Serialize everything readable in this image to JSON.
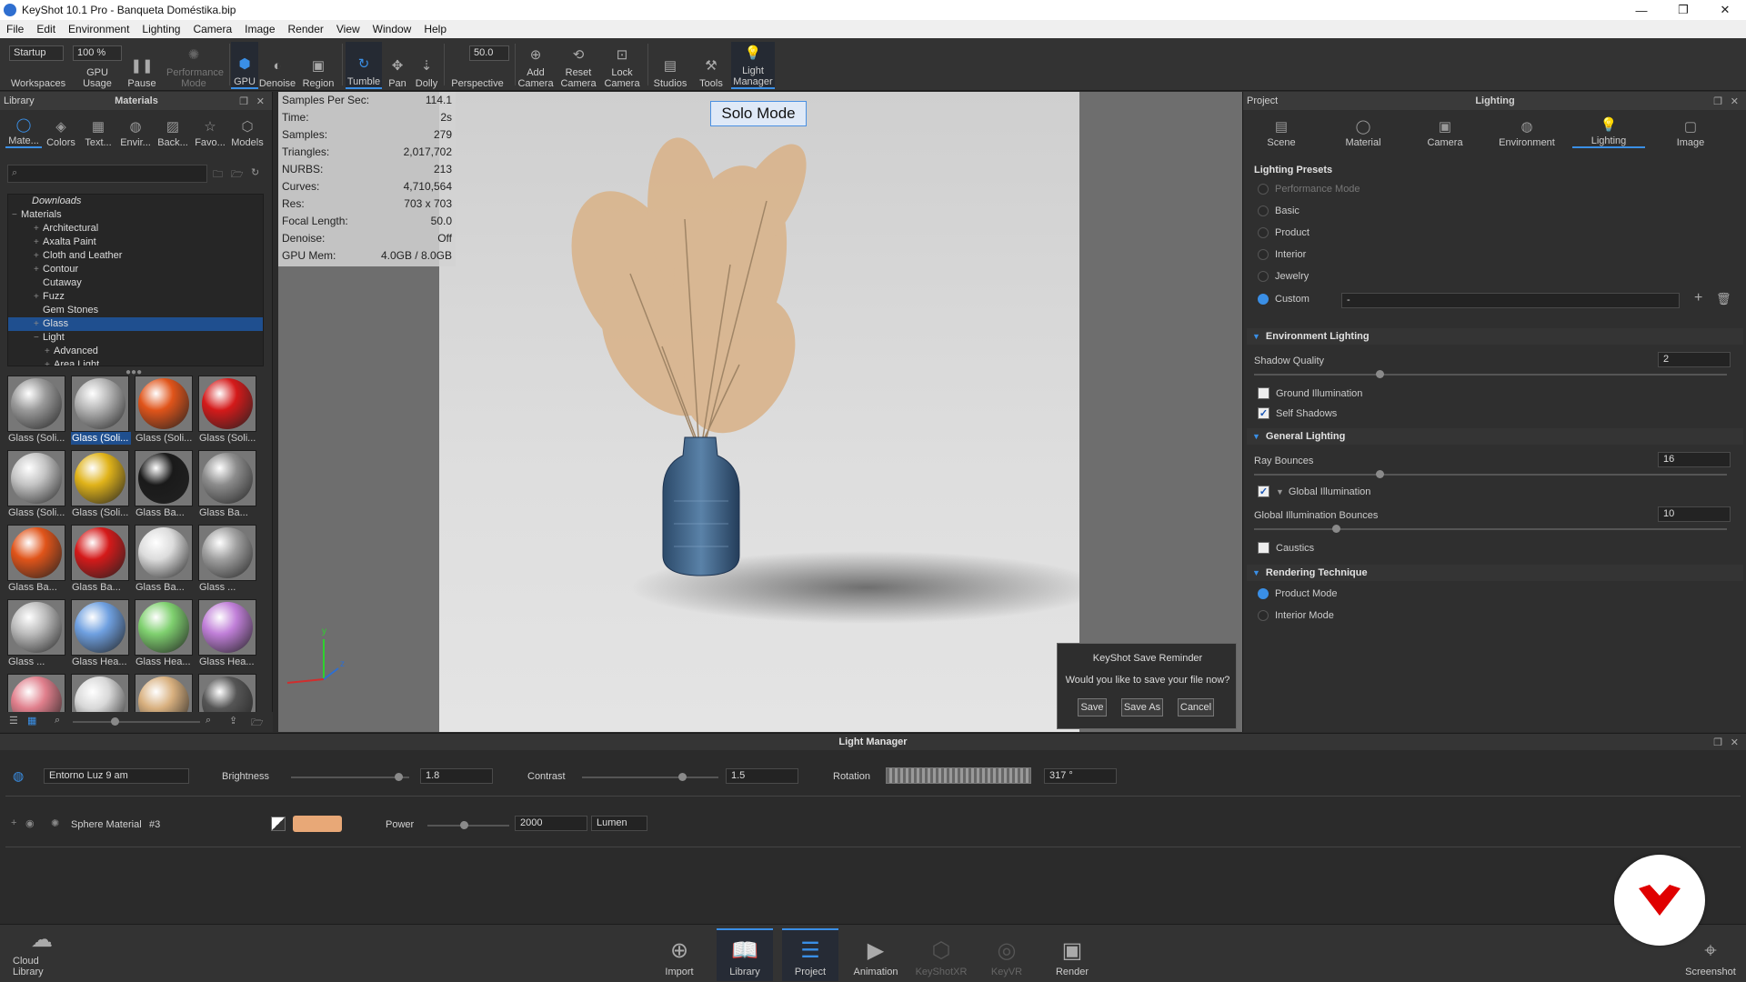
{
  "window": {
    "title": "KeyShot 10.1 Pro  - Banqueta Doméstika.bip"
  },
  "menu": [
    "File",
    "Edit",
    "Environment",
    "Lighting",
    "Camera",
    "Image",
    "Render",
    "View",
    "Window",
    "Help"
  ],
  "ribbon": {
    "workspace_select": "Startup",
    "zoom_select": "100 %",
    "focal_value": "50.0",
    "items": [
      "Workspaces",
      "GPU Usage",
      "Pause",
      "Performance Mode",
      "GPU",
      "Denoise",
      "Region",
      "Tumble",
      "Pan",
      "Dolly",
      "Perspective",
      "Add Camera",
      "Reset Camera",
      "Lock Camera",
      "Studios",
      "Tools",
      "Light Manager"
    ]
  },
  "library": {
    "title": "Library",
    "subtitle": "Materials",
    "tabs": [
      "Mate...",
      "Colors",
      "Text...",
      "Envir...",
      "Back...",
      "Favo...",
      "Models"
    ],
    "tree": [
      {
        "label": "Downloads",
        "indent": 1,
        "pm": "",
        "italic": true
      },
      {
        "label": "Materials",
        "indent": 0,
        "pm": "−"
      },
      {
        "label": "Architectural",
        "indent": 2,
        "pm": "+"
      },
      {
        "label": "Axalta Paint",
        "indent": 2,
        "pm": "+"
      },
      {
        "label": "Cloth and Leather",
        "indent": 2,
        "pm": "+"
      },
      {
        "label": "Contour",
        "indent": 2,
        "pm": "+"
      },
      {
        "label": "Cutaway",
        "indent": 2,
        "pm": ""
      },
      {
        "label": "Fuzz",
        "indent": 2,
        "pm": "+"
      },
      {
        "label": "Gem Stones",
        "indent": 2,
        "pm": ""
      },
      {
        "label": "Glass",
        "indent": 2,
        "pm": "+",
        "selected": true
      },
      {
        "label": "Light",
        "indent": 2,
        "pm": "−"
      },
      {
        "label": "Advanced",
        "indent": 3,
        "pm": "+"
      },
      {
        "label": "Area Light",
        "indent": 3,
        "pm": "+"
      }
    ],
    "thumbs": [
      {
        "label": "Glass (Soli...",
        "color": "#9a9a9a"
      },
      {
        "label": "Glass (Soli...",
        "color": "#b5b5b5",
        "selected": true
      },
      {
        "label": "Glass (Soli...",
        "color": "#e0541a"
      },
      {
        "label": "Glass (Soli...",
        "color": "#d41a1a"
      },
      {
        "label": "Glass (Soli...",
        "color": "#c4c4c4"
      },
      {
        "label": "Glass (Soli...",
        "color": "#e0b31a"
      },
      {
        "label": "Glass Ba...",
        "color": "#1a1a1a"
      },
      {
        "label": "Glass Ba...",
        "color": "#8c8c8c"
      },
      {
        "label": "Glass Ba...",
        "color": "#e0541a"
      },
      {
        "label": "Glass Ba...",
        "color": "#d41a1a"
      },
      {
        "label": "Glass Ba...",
        "color": "#dcdcdc"
      },
      {
        "label": "Glass ...",
        "color": "#a0a0a0"
      },
      {
        "label": "Glass ...",
        "color": "#bcbcbc"
      },
      {
        "label": "Glass Hea...",
        "color": "#6fa0e0"
      },
      {
        "label": "Glass Hea...",
        "color": "#7fd06f"
      },
      {
        "label": "Glass Hea...",
        "color": "#c07fd8"
      },
      {
        "label": "",
        "color": "#e07f8c"
      },
      {
        "label": "",
        "color": "#d8d8d8"
      },
      {
        "label": "",
        "color": "#d8b07f"
      },
      {
        "label": "",
        "color": "#555555"
      }
    ]
  },
  "stats": [
    {
      "k": "Samples Per Sec:",
      "v": "114.1"
    },
    {
      "k": "Time:",
      "v": "2s"
    },
    {
      "k": "Samples:",
      "v": "279"
    },
    {
      "k": "Triangles:",
      "v": "2,017,702"
    },
    {
      "k": "NURBS:",
      "v": "213"
    },
    {
      "k": "Curves:",
      "v": "4,710,564"
    },
    {
      "k": "Res:",
      "v": "703 x 703"
    },
    {
      "k": "Focal Length:",
      "v": "50.0"
    },
    {
      "k": "Denoise:",
      "v": "Off"
    },
    {
      "k": "GPU Mem:",
      "v": "4.0GB / 8.0GB"
    }
  ],
  "viewport": {
    "solo_mode": "Solo Mode",
    "axis_y": "y",
    "axis_z": "z"
  },
  "project": {
    "title": "Project",
    "subtitle": "Lighting",
    "tabs": [
      "Scene",
      "Material",
      "Camera",
      "Environment",
      "Lighting",
      "Image"
    ],
    "presets_title": "Lighting Presets",
    "presets": [
      "Performance Mode",
      "Basic",
      "Product",
      "Interior",
      "Jewelry",
      "Custom"
    ],
    "custom_value": "-",
    "env_lighting": "Environment Lighting",
    "shadow_quality_label": "Shadow Quality",
    "shadow_quality": "2",
    "ground_illumination": "Ground Illumination",
    "self_shadows": "Self Shadows",
    "general_lighting": "General Lighting",
    "ray_bounces_label": "Ray Bounces",
    "ray_bounces": "16",
    "global_illumination": "Global Illumination",
    "gi_bounces_label": "Global Illumination Bounces",
    "gi_bounces": "10",
    "caustics": "Caustics",
    "rendering_technique": "Rendering Technique",
    "product_mode": "Product Mode",
    "interior_mode": "Interior Mode"
  },
  "dialog": {
    "title": "KeyShot Save Reminder",
    "message": "Would you like to save your file now?",
    "save": "Save",
    "save_as": "Save As",
    "cancel": "Cancel"
  },
  "light_manager": {
    "title": "Light Manager",
    "environment": "Entorno Luz 9 am",
    "brightness_label": "Brightness",
    "brightness": "1.8",
    "contrast_label": "Contrast",
    "contrast": "1.5",
    "rotation_label": "Rotation",
    "rotation": "317 °",
    "light_name": "Sphere Material",
    "light_id": "#3",
    "light_color": "#e8a877",
    "power_label": "Power",
    "power": "2000",
    "unit": "Lumen"
  },
  "dock": {
    "cloud_library": "Cloud Library",
    "items": [
      "Import",
      "Library",
      "Project",
      "Animation",
      "KeyShotXR",
      "KeyVR",
      "Render"
    ],
    "screenshot": "Screenshot"
  }
}
